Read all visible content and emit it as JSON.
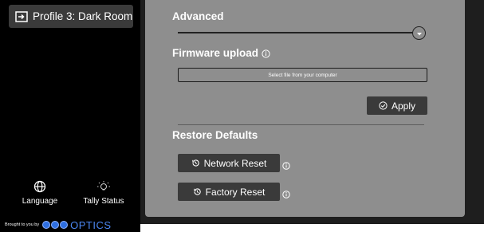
{
  "sidebar": {
    "profile_label": "Profile 3: Dark Room",
    "nav": {
      "language_label": "Language",
      "tally_label": "Tally Status"
    },
    "brand": {
      "brought_text": "Brought to you by",
      "brand_name": "OPTICS"
    }
  },
  "main": {
    "advanced": {
      "title": "Advanced",
      "slider_value": 1.0
    },
    "firmware": {
      "title": "Firmware upload",
      "file_button_label": "Select file from your computer",
      "apply_label": "Apply"
    },
    "restore": {
      "title": "Restore Defaults",
      "network_reset_label": "Network Reset",
      "factory_reset_label": "Factory Reset"
    }
  },
  "colors": {
    "sidebar_bg": "#000000",
    "panel_bg": "#8e8e8e",
    "button_bg": "#3a3a3a",
    "brand_blue": "#2f6fe0"
  }
}
